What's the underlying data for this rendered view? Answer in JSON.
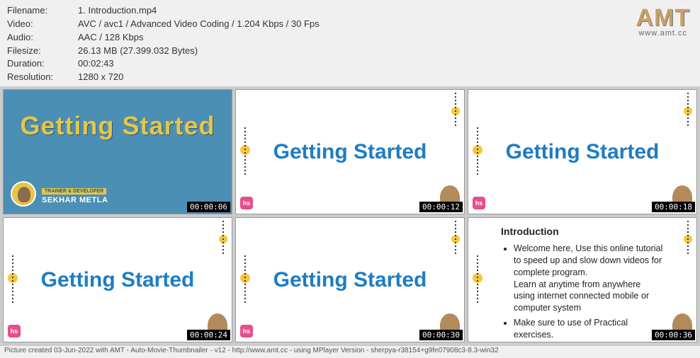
{
  "meta": {
    "filename_label": "Filename:",
    "filename": "1. Introduction.mp4",
    "video_label": "Video:",
    "video": "AVC / avc1 / Advanced Video Coding / 1.204 Kbps / 30 Fps",
    "audio_label": "Audio:",
    "audio": "AAC / 128 Kbps",
    "filesize_label": "Filesize:",
    "filesize": "26.13 MB (27.399.032 Bytes)",
    "duration_label": "Duration:",
    "duration": "00:02:43",
    "resolution_label": "Resolution:",
    "resolution": "1280 x 720"
  },
  "watermark": {
    "logo": "AMT",
    "url": "www.amt.cc"
  },
  "thumbs": [
    {
      "title": "Getting Started",
      "time": "00:00:06",
      "role": "TRAINER & DEVELOPER",
      "author": "SEKHAR METLA"
    },
    {
      "title": "Getting Started",
      "time": "00:00:12"
    },
    {
      "title": "Getting Started",
      "time": "00:00:18"
    },
    {
      "title": "Getting Started",
      "time": "00:00:24"
    },
    {
      "title": "Getting Started",
      "time": "00:00:30"
    },
    {
      "heading": "Introduction",
      "bullet1": "Welcome here, Use this online tutorial to speed up and slow down videos for complete program.",
      "bullet1b": "Learn at anytime from anywhere using internet connected mobile or computer system",
      "bullet2": "Make sure to use of Practical exercises.",
      "time": "00:00:36"
    }
  ],
  "hs": "hs",
  "footer": "Picture created 03-Jun-2022 with AMT - Auto-Movie-Thumbnailer - v12 - http://www.amt.cc - using MPlayer Version - sherpya-r38154+g9fe07908c3-8.3-win32"
}
